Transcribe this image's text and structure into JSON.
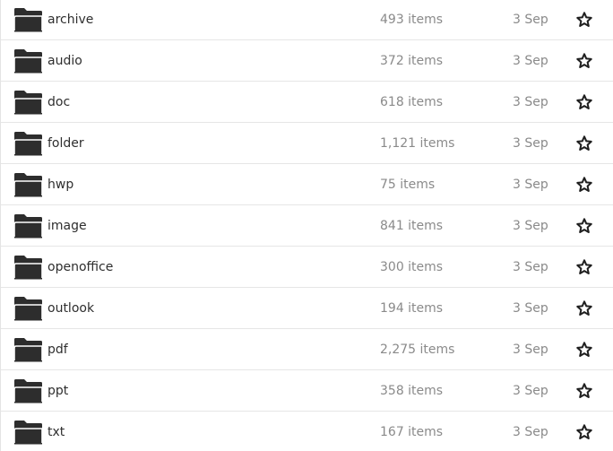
{
  "file_list": {
    "rows": [
      {
        "name": "archive",
        "count": "493 items",
        "date": "3 Sep"
      },
      {
        "name": "audio",
        "count": "372 items",
        "date": "3 Sep"
      },
      {
        "name": "doc",
        "count": "618 items",
        "date": "3 Sep"
      },
      {
        "name": "folder",
        "count": "1,121 items",
        "date": "3 Sep"
      },
      {
        "name": "hwp",
        "count": "75 items",
        "date": "3 Sep"
      },
      {
        "name": "image",
        "count": "841 items",
        "date": "3 Sep"
      },
      {
        "name": "openoffice",
        "count": "300 items",
        "date": "3 Sep"
      },
      {
        "name": "outlook",
        "count": "194 items",
        "date": "3 Sep"
      },
      {
        "name": "pdf",
        "count": "2,275 items",
        "date": "3 Sep"
      },
      {
        "name": "ppt",
        "count": "358 items",
        "date": "3 Sep"
      },
      {
        "name": "txt",
        "count": "167 items",
        "date": "3 Sep"
      }
    ],
    "icons": {
      "folder": "folder-icon",
      "star": "star-outline-icon"
    },
    "colors": {
      "folder": "#2d2d2d",
      "name_text": "#2e2e2e",
      "meta_text": "#8a8a8a",
      "divider": "#e6e6e6"
    }
  }
}
